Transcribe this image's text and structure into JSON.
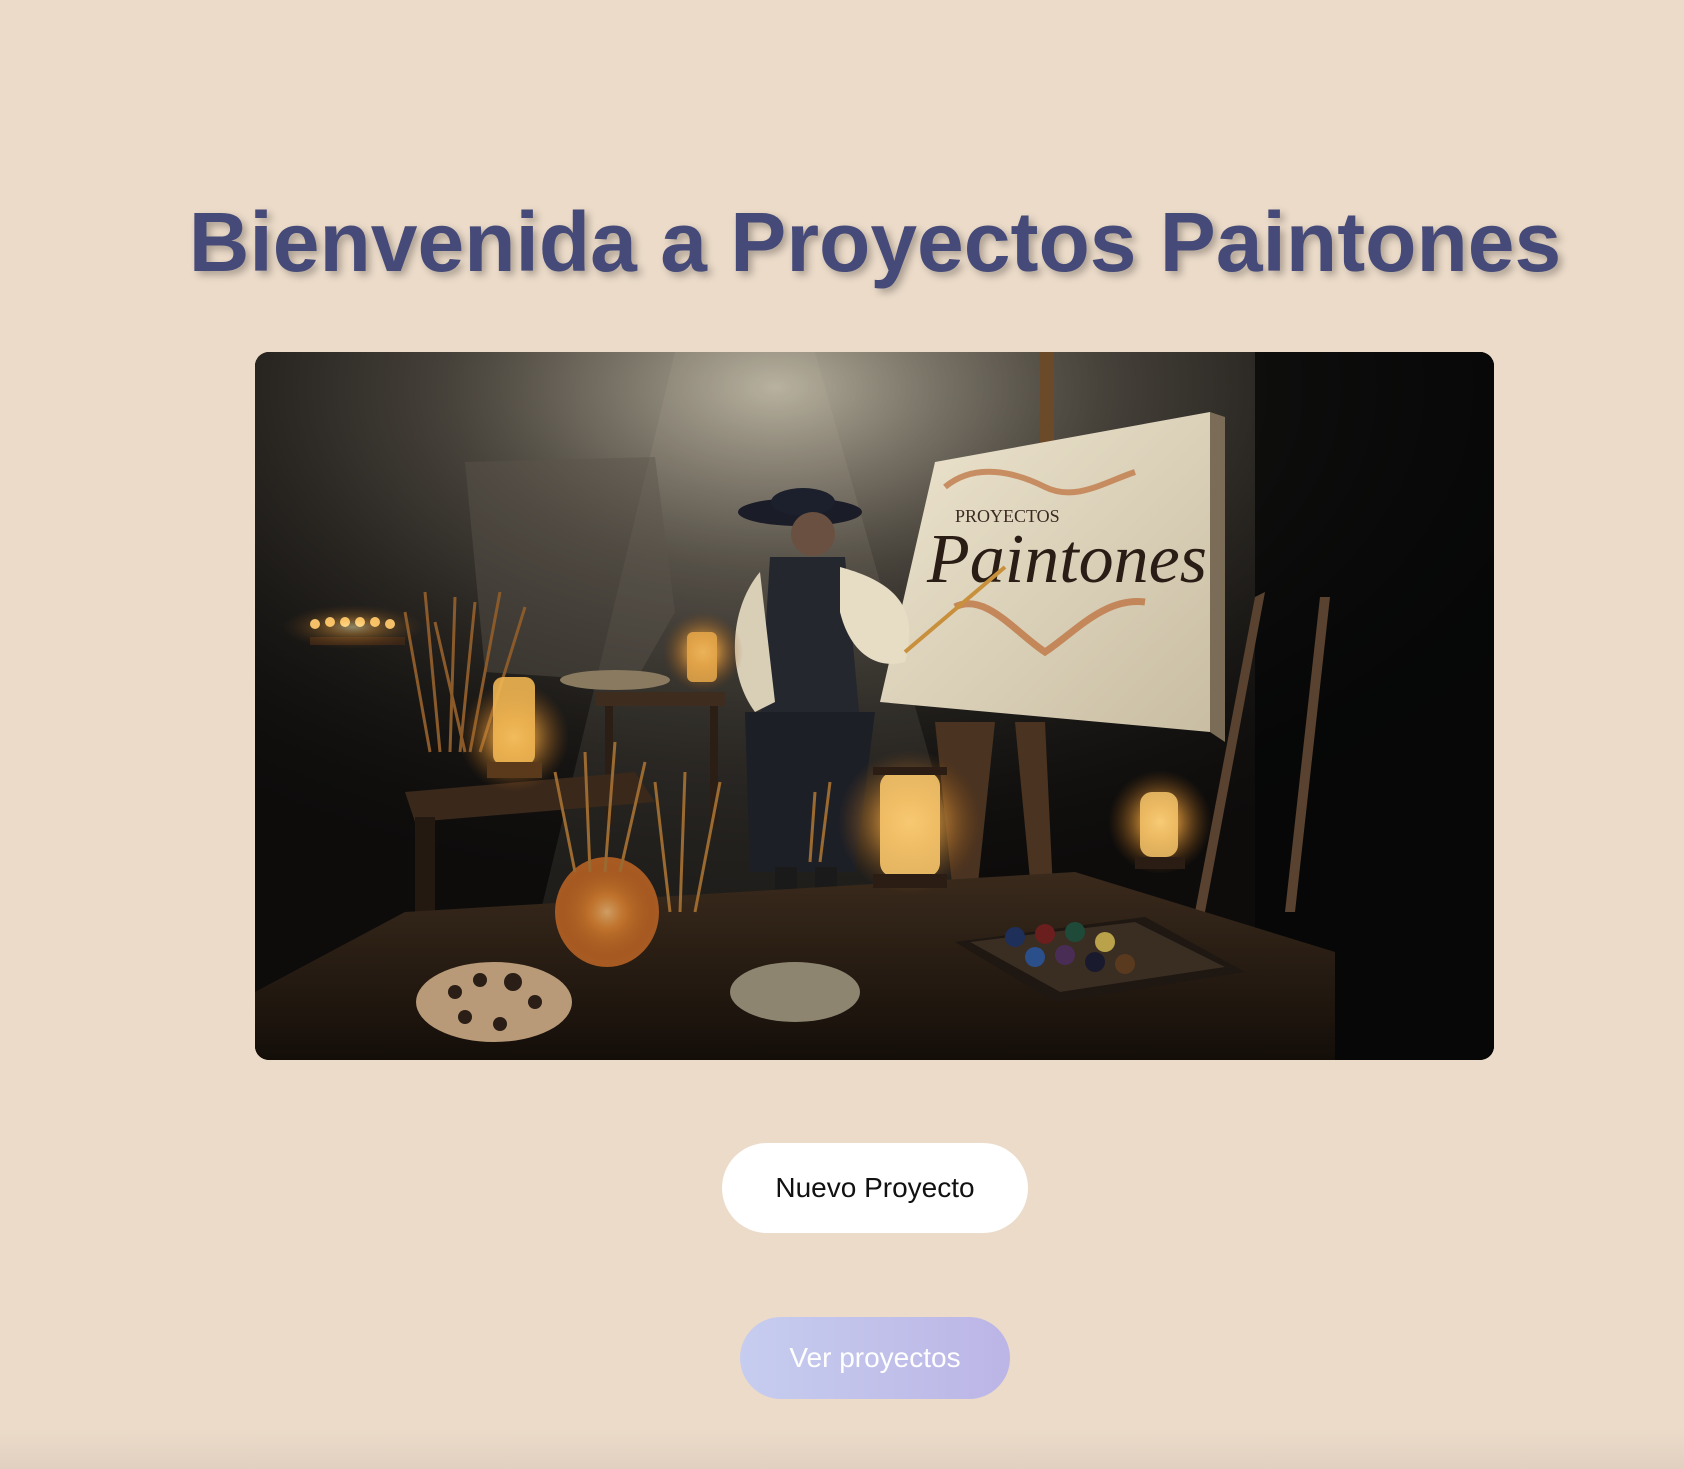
{
  "page": {
    "title": "Bienvenida a Proyectos Paintones"
  },
  "hero_image": {
    "canvas_small_text": "PROYECTOS",
    "canvas_large_text": "Paintones"
  },
  "actions": {
    "new_project_label": "Nuevo Proyecto",
    "view_projects_label": "Ver proyectos"
  },
  "colors": {
    "background": "#ecdbc9",
    "title": "#454a78",
    "primary_button_bg": "#ffffff",
    "secondary_button_gradient": [
      "#c6cdef",
      "#bcb5e6"
    ]
  }
}
